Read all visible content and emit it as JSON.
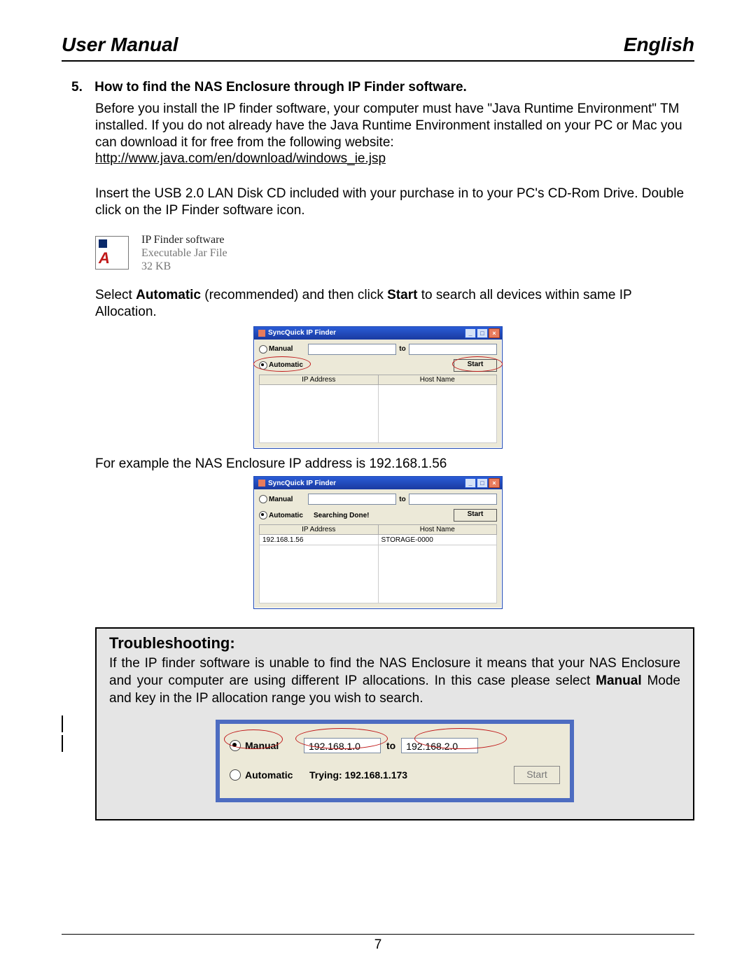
{
  "header": {
    "left": "User Manual",
    "right": "English"
  },
  "section": {
    "number": "5.",
    "title": "How to find the NAS Enclosure through IP Finder software."
  },
  "intro_para": "Before you install the IP finder software, your computer must have \"Java Runtime Environment\" TM installed. If you do not already have the Java Runtime Environment installed on your PC or Mac you can download it for free from the following website:",
  "download_url": "http://www.java.com/en/download/windows_ie.jsp",
  "insert_para": "Insert the USB 2.0 LAN Disk CD included with your purchase in to your PC's CD-Rom Drive. Double click on the IP Finder software icon.",
  "file_icon": {
    "name": "IP Finder software",
    "type": "Executable Jar File",
    "size": "32 KB"
  },
  "select_para_1": "Select ",
  "select_bold_1": "Automatic",
  "select_para_2": " (recommended) and then click ",
  "select_bold_2": "Start",
  "select_para_3": " to search all devices within same IP Allocation.",
  "dialog1": {
    "title": "SyncQuick IP Finder",
    "radio_manual": "Manual",
    "radio_auto": "Automatic",
    "to_label": "to",
    "start_button": "Start",
    "col_ip": "IP Address",
    "col_host": "Host Name",
    "status": ""
  },
  "example_line": "For example the NAS Enclosure IP address is 192.168.1.56",
  "dialog2": {
    "title": "SyncQuick IP Finder",
    "radio_manual": "Manual",
    "radio_auto": "Automatic",
    "to_label": "to",
    "start_button": "Start",
    "status": "Searching Done!",
    "col_ip": "IP Address",
    "col_host": "Host Name",
    "row": {
      "ip": "192.168.1.56",
      "host": "STORAGE-0000"
    }
  },
  "troubleshoot": {
    "heading": "Troubleshooting:",
    "body_pre": "If the IP finder software is unable to find the NAS Enclosure it means that your NAS Enclosure and your computer are using different IP allocations. In this case please select ",
    "body_bold": "Manual",
    "body_post": " Mode and key in the IP allocation range you wish to search.",
    "dialog": {
      "radio_manual": "Manual",
      "radio_auto": "Automatic",
      "ip_from": "192.168.1.0",
      "to_label": "to",
      "ip_to": "192.168.2.0",
      "status": "Trying: 192.168.1.173",
      "start_button": "Start"
    }
  },
  "page_number": "7"
}
